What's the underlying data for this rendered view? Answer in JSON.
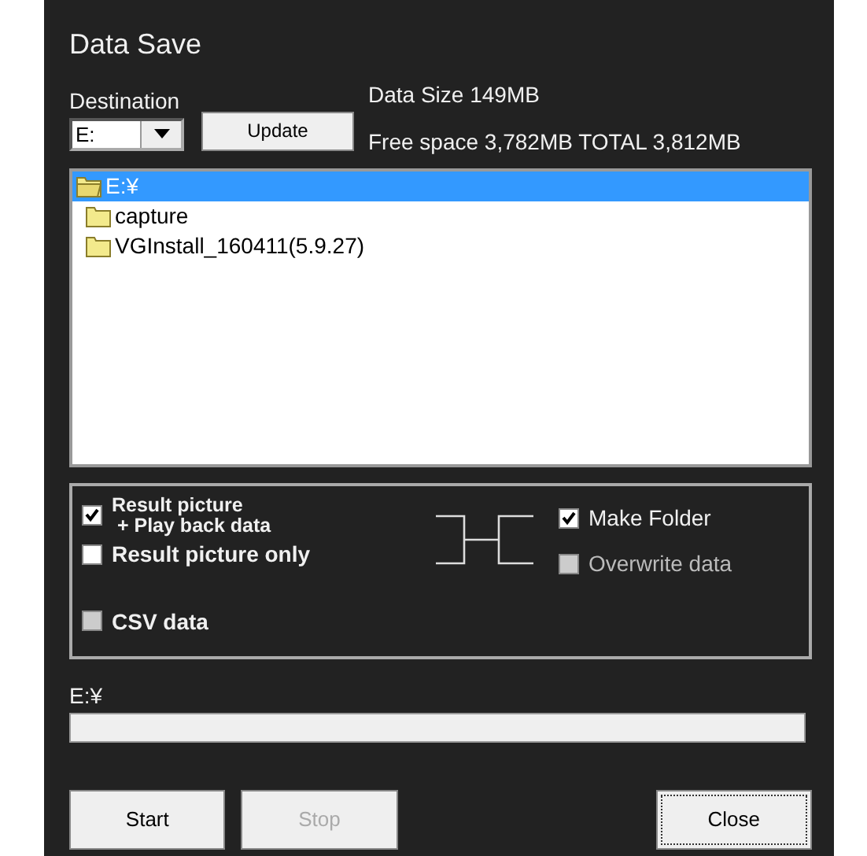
{
  "title": "Data Save",
  "destination": {
    "label": "Destination",
    "value": "E:",
    "update_button": "Update"
  },
  "info": {
    "data_size": "Data Size 149MB",
    "free_space": "Free space 3,782MB TOTAL 3,812MB"
  },
  "tree": [
    {
      "label": "E:¥",
      "selected": true,
      "expanded": true,
      "children": [
        {
          "label": "capture",
          "selected": false
        },
        {
          "label": "VGInstall_160411(5.9.27)",
          "selected": false
        }
      ]
    }
  ],
  "options_left": [
    {
      "label": "Result picture\n + Play back data",
      "checked": true,
      "disabled": false
    },
    {
      "label": "Result picture only",
      "checked": false,
      "disabled": false
    },
    {
      "label": "CSV data",
      "checked": false,
      "disabled": true
    }
  ],
  "options_right": [
    {
      "label": "Make Folder",
      "checked": true,
      "disabled": false
    },
    {
      "label": "Overwrite data",
      "checked": false,
      "disabled": true
    }
  ],
  "progress": {
    "label": "E:¥",
    "level": 0
  },
  "buttons": [
    {
      "label": "Start",
      "disabled": false,
      "focused": false
    },
    {
      "label": "Stop",
      "disabled": true,
      "focused": false
    },
    {
      "label": "Close",
      "disabled": false,
      "focused": true
    }
  ]
}
